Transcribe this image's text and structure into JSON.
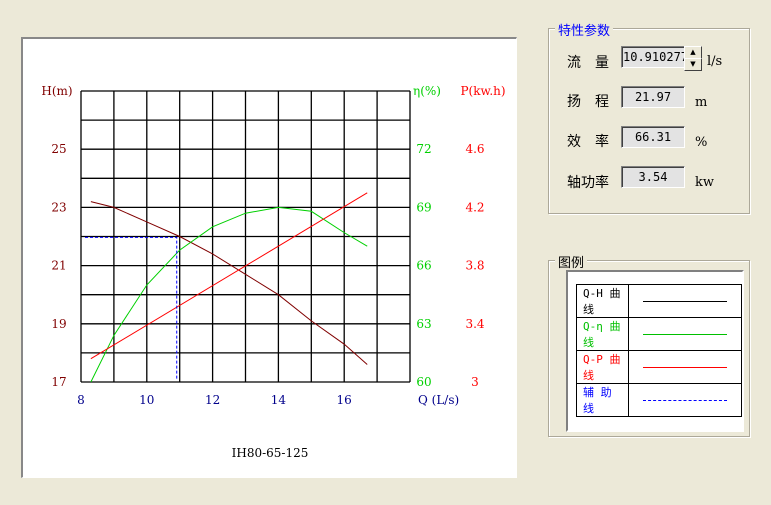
{
  "params": {
    "title": "特性参数",
    "flow_label": "流　量",
    "flow_value": "10.910277",
    "flow_unit": "l/s",
    "head_label": "扬　程",
    "head_value": "21.97",
    "head_unit": "m",
    "eff_label": "效　率",
    "eff_value": "66.31",
    "eff_unit": "%",
    "power_label": "轴功率",
    "power_value": "3.54",
    "power_unit": "kw"
  },
  "legend": {
    "title": "图例",
    "items": [
      {
        "label": "Q-H 曲线",
        "color": "#000000",
        "style": "solid"
      },
      {
        "label": "Q-η 曲线",
        "color": "#00c000",
        "style": "solid"
      },
      {
        "label": "Q-P 曲线",
        "color": "#ff0000",
        "style": "solid"
      },
      {
        "label": "辅 助 线",
        "color": "#0000ff",
        "style": "dashed"
      }
    ]
  },
  "chart_data": {
    "type": "line",
    "title": "IH80-65-125",
    "xlabel": "Q (L/s)",
    "xlim": [
      8,
      18
    ],
    "xticks": [
      8,
      10,
      12,
      14,
      16
    ],
    "h_axis": {
      "label": "H(m)",
      "lim": [
        17,
        27
      ],
      "ticks": [
        17,
        19,
        21,
        23,
        25
      ],
      "color": "#800000"
    },
    "eff_axis": {
      "label": "η(%)",
      "lim": [
        60,
        75
      ],
      "ticks": [
        60,
        63,
        66,
        69,
        72
      ],
      "color": "#00d000"
    },
    "p_axis": {
      "label": "P(kw.h)",
      "lim": [
        3,
        5
      ],
      "ticks": [
        "3",
        "3.4",
        "3.8",
        "4.2",
        "4.6"
      ],
      "color": "#ff0000"
    },
    "series": [
      {
        "name": "Q-H",
        "axis": "h",
        "color": "#800000",
        "x": [
          8.3,
          9,
          10,
          11,
          12,
          13,
          14,
          15,
          16,
          16.7
        ],
        "y": [
          23.2,
          23.0,
          22.5,
          22.0,
          21.4,
          20.7,
          20.0,
          19.1,
          18.3,
          17.6
        ]
      },
      {
        "name": "Q-η",
        "axis": "eff",
        "color": "#00d000",
        "x": [
          8.3,
          9,
          10,
          11,
          12,
          13,
          14,
          15,
          16,
          16.7
        ],
        "y": [
          60.0,
          62.4,
          65.0,
          66.8,
          68.0,
          68.7,
          69.0,
          68.8,
          67.7,
          67.0
        ]
      },
      {
        "name": "Q-P",
        "axis": "p",
        "color": "#ff0000",
        "x": [
          8.3,
          16.7
        ],
        "y": [
          3.16,
          4.3
        ]
      }
    ],
    "aux": {
      "q": 10.91,
      "h": 21.97,
      "color": "#0000ff"
    }
  }
}
